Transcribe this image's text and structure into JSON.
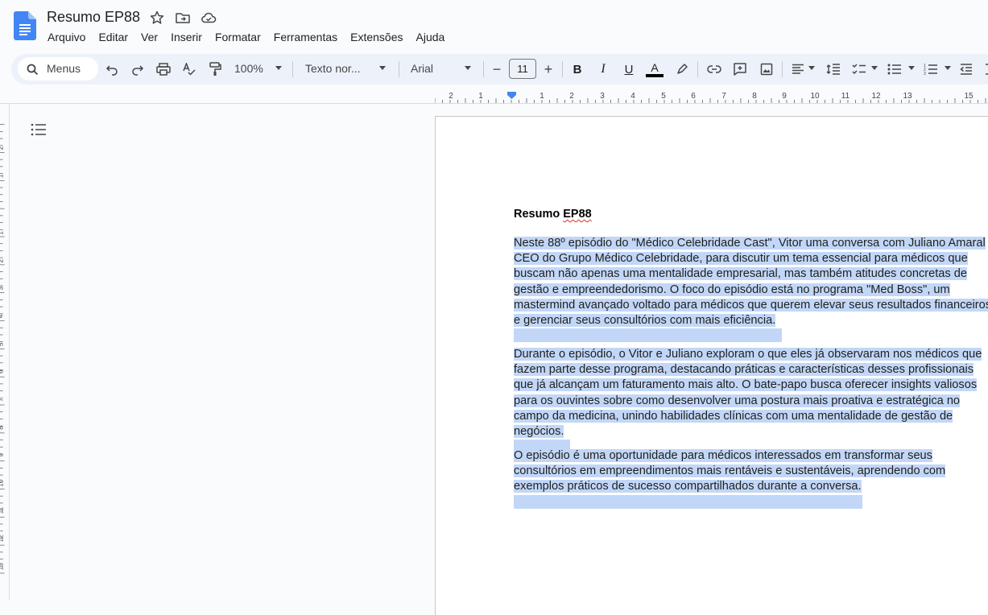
{
  "doc": {
    "title": "Resumo EP88"
  },
  "menu": [
    "Arquivo",
    "Editar",
    "Ver",
    "Inserir",
    "Formatar",
    "Ferramentas",
    "Extensões",
    "Ajuda"
  ],
  "toolbar": {
    "search_label": "Menus",
    "zoom": "100%",
    "style": "Texto nor...",
    "font": "Arial",
    "font_size": "11"
  },
  "ruler": {
    "ticks": [
      "2",
      "1",
      "1",
      "2",
      "3",
      "4",
      "5",
      "6",
      "7",
      "8",
      "9",
      "10",
      "11",
      "12",
      "13",
      "15"
    ],
    "left_ticks": [
      "2",
      "1",
      "1",
      "2",
      "3",
      "4",
      "5",
      "6",
      "7",
      "8",
      "9",
      "10",
      "11",
      "12",
      "13"
    ]
  },
  "content": {
    "heading_plain": "Resumo ",
    "heading_squiggle": "EP88",
    "paragraphs": [
      [
        "Neste 88º episódio do \"Médico Celebridade Cast\", Vitor uma conversa com Juliano Amaral",
        "CEO do Grupo Médico Celebridade, para discutir um tema essencial para médicos que",
        "buscam não apenas uma mentalidade empresarial, mas também atitudes concretas de",
        "gestão e empreendedorismo. O foco do episódio está no programa \"Med Boss\", um",
        "mastermind avançado voltado para médicos que querem elevar seus resultados financeiros",
        "e gerenciar seus consultórios com mais eficiência."
      ],
      [
        "Durante o episódio, o Vitor e Juliano exploram o que eles já observaram nos médicos que",
        "fazem parte desse programa, destacando práticas e características desses profissionais",
        "que já alcançam um faturamento mais alto. O bate-papo busca oferecer insights valiosos",
        "para os ouvintes sobre como desenvolver uma postura mais proativa e estratégica no",
        "campo da medicina, unindo habilidades clínicas com uma mentalidade de gestão de",
        "negócios."
      ],
      [
        "O episódio é uma oportunidade para médicos interessados em transformar seus",
        "consultórios em empreendimentos mais rentáveis e sustentáveis, aprendendo com",
        "exemplos práticos de sucesso compartilhados durante a conversa."
      ]
    ]
  },
  "colors": {
    "selection": "#c2d7f7",
    "accent": "#4285f4",
    "toolbar_bg": "#edf2fa"
  },
  "icons": [
    "docs-logo-icon",
    "star-icon",
    "move-folder-icon",
    "cloud-saved-icon",
    "search-icon",
    "undo-icon",
    "redo-icon",
    "print-icon",
    "spellcheck-icon",
    "paint-format-icon",
    "bold-icon",
    "italic-icon",
    "underline-icon",
    "text-color-icon",
    "highlight-icon",
    "link-icon",
    "add-comment-icon",
    "insert-image-icon",
    "align-icon",
    "line-spacing-icon",
    "checklist-icon",
    "bulleted-list-icon",
    "numbered-list-icon",
    "decrease-indent-icon",
    "outline-icon"
  ]
}
